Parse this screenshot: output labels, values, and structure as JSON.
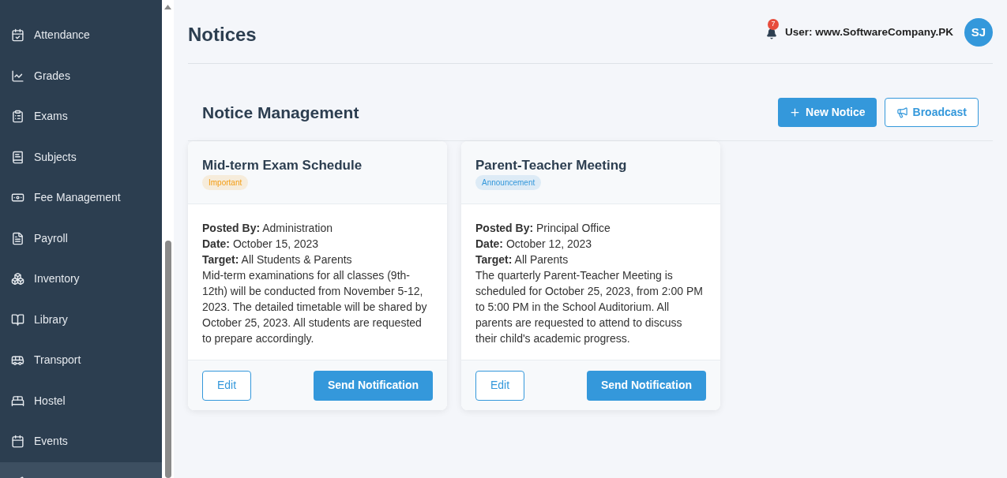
{
  "sidebar": {
    "items": [
      {
        "label": "Attendance",
        "selected": false
      },
      {
        "label": "Grades",
        "selected": false
      },
      {
        "label": "Exams",
        "selected": false
      },
      {
        "label": "Subjects",
        "selected": false
      },
      {
        "label": "Fee Management",
        "selected": false
      },
      {
        "label": "Payroll",
        "selected": false
      },
      {
        "label": "Inventory",
        "selected": false
      },
      {
        "label": "Library",
        "selected": false
      },
      {
        "label": "Transport",
        "selected": false
      },
      {
        "label": "Hostel",
        "selected": false
      },
      {
        "label": "Events",
        "selected": false
      },
      {
        "selected": true
      }
    ]
  },
  "header": {
    "title": "Notices",
    "notification_count": "7",
    "user_label": "User:",
    "user_name": "www.SoftwareCompany.PK",
    "avatar": "SJ"
  },
  "section": {
    "title": "Notice Management",
    "buttons": [
      {
        "label": "New Notice",
        "kind": "primary"
      },
      {
        "label": "Broadcast",
        "kind": "outline"
      }
    ]
  },
  "notices": [
    {
      "title": "Mid-term Exam Schedule",
      "tag": "Important",
      "color": "#f39c12",
      "posted_by_label": "Posted By:",
      "posted_by": "Administration",
      "date_label": "Date:",
      "date": "October 15, 2023",
      "target_label": "Target:",
      "target": "All Students & Parents",
      "body": "Mid-term examinations for all classes (9th-12th) will be conducted from November 5-12, 2023. The detailed timetable will be shared by October 25, 2023. All students are requested to prepare accordingly.",
      "edit": "Edit",
      "send": "Send Notification"
    },
    {
      "title": "Parent-Teacher Meeting",
      "tag": "Announcement",
      "color": "#3498db",
      "posted_by_label": "Posted By:",
      "posted_by": "Principal Office",
      "date_label": "Date:",
      "date": "October 12, 2023",
      "target_label": "Target:",
      "target": "All Parents",
      "body": "The quarterly Parent-Teacher Meeting is scheduled for October 25, 2023, from 2:00 PM to 5:00 PM in the School Auditorium. All parents are requested to attend to discuss their child's academic progress.",
      "edit": "Edit",
      "send": "Send Notification"
    }
  ]
}
